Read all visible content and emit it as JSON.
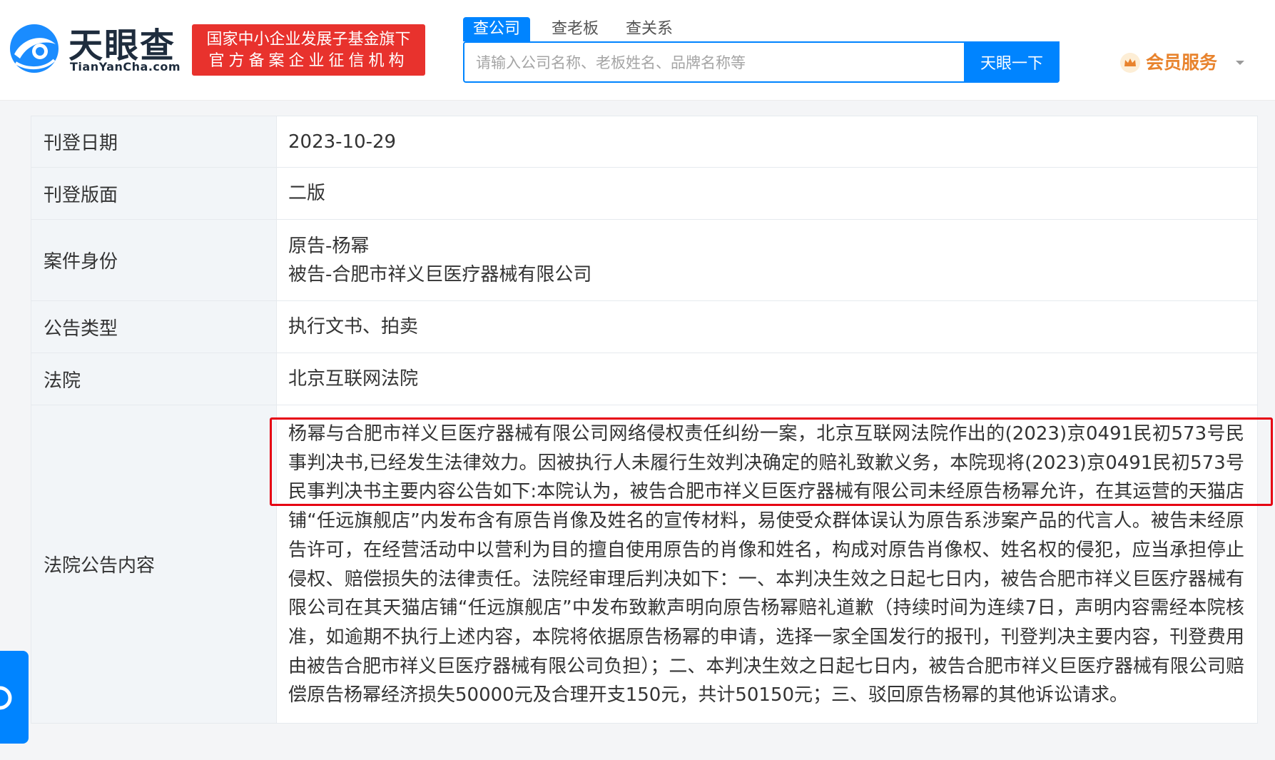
{
  "header": {
    "logo_cn": "天眼查",
    "logo_en": "TianYanCha.com",
    "badge_line1": "国家中小企业发展子基金旗下",
    "badge_line2": "官方备案企业征信机构",
    "tabs": [
      "查公司",
      "查老板",
      "查关系"
    ],
    "search_placeholder": "请输入公司名称、老板姓名、品牌名称等",
    "search_button": "天眼一下",
    "member_label": "会员服务"
  },
  "colors": {
    "brand_blue": "#0084ff",
    "badge_red": "#e8322d",
    "member_orange": "#e8832d",
    "highlight_red": "#e60012"
  },
  "table": {
    "rows": [
      {
        "label": "刊登日期",
        "value": "2023-10-29"
      },
      {
        "label": "刊登版面",
        "value": "二版"
      },
      {
        "label": "案件身份",
        "value_lines": [
          "原告-杨幂",
          "被告-合肥市祥义巨医疗器械有限公司"
        ]
      },
      {
        "label": "公告类型",
        "value": "执行文书、拍卖"
      },
      {
        "label": "法院",
        "value": "北京互联网法院"
      },
      {
        "label": "法院公告内容",
        "value": "杨幂与合肥市祥义巨医疗器械有限公司网络侵权责任纠纷一案，北京互联网法院作出的(2023)京0491民初573号民事判决书,已经发生法律效力。因被执行人未履行生效判决确定的赔礼致歉义务，本院现将(2023)京0491民初573号民事判决书主要内容公告如下:本院认为，被告合肥市祥义巨医疗器械有限公司未经原告杨幂允许，在其运营的天猫店铺“任远旗舰店”内发布含有原告肖像及姓名的宣传材料，易使受众群体误认为原告系涉案产品的代言人。被告未经原告许可，在经营活动中以营利为目的擅自使用原告的肖像和姓名，构成对原告肖像权、姓名权的侵犯，应当承担停止侵权、赔偿损失的法律责任。法院经审理后判决如下：一、本判决生效之日起七日内，被告合肥市祥义巨医疗器械有限公司在其天猫店铺“任远旗舰店”中发布致歉声明向原告杨幂赔礼道歉（持续时间为连续7日，声明内容需经本院核准，如逾期不执行上述内容，本院将依据原告杨幂的申请，选择一家全国发行的报刊，刊登判决主要内容，刊登费用由被告合肥市祥义巨医疗器械有限公司负担）；二、本判决生效之日起七日内，被告合肥市祥义巨医疗器械有限公司赔偿原告杨幂经济损失50000元及合理开支150元，共计50150元；三、驳回原告杨幂的其他诉讼请求。"
      }
    ]
  }
}
